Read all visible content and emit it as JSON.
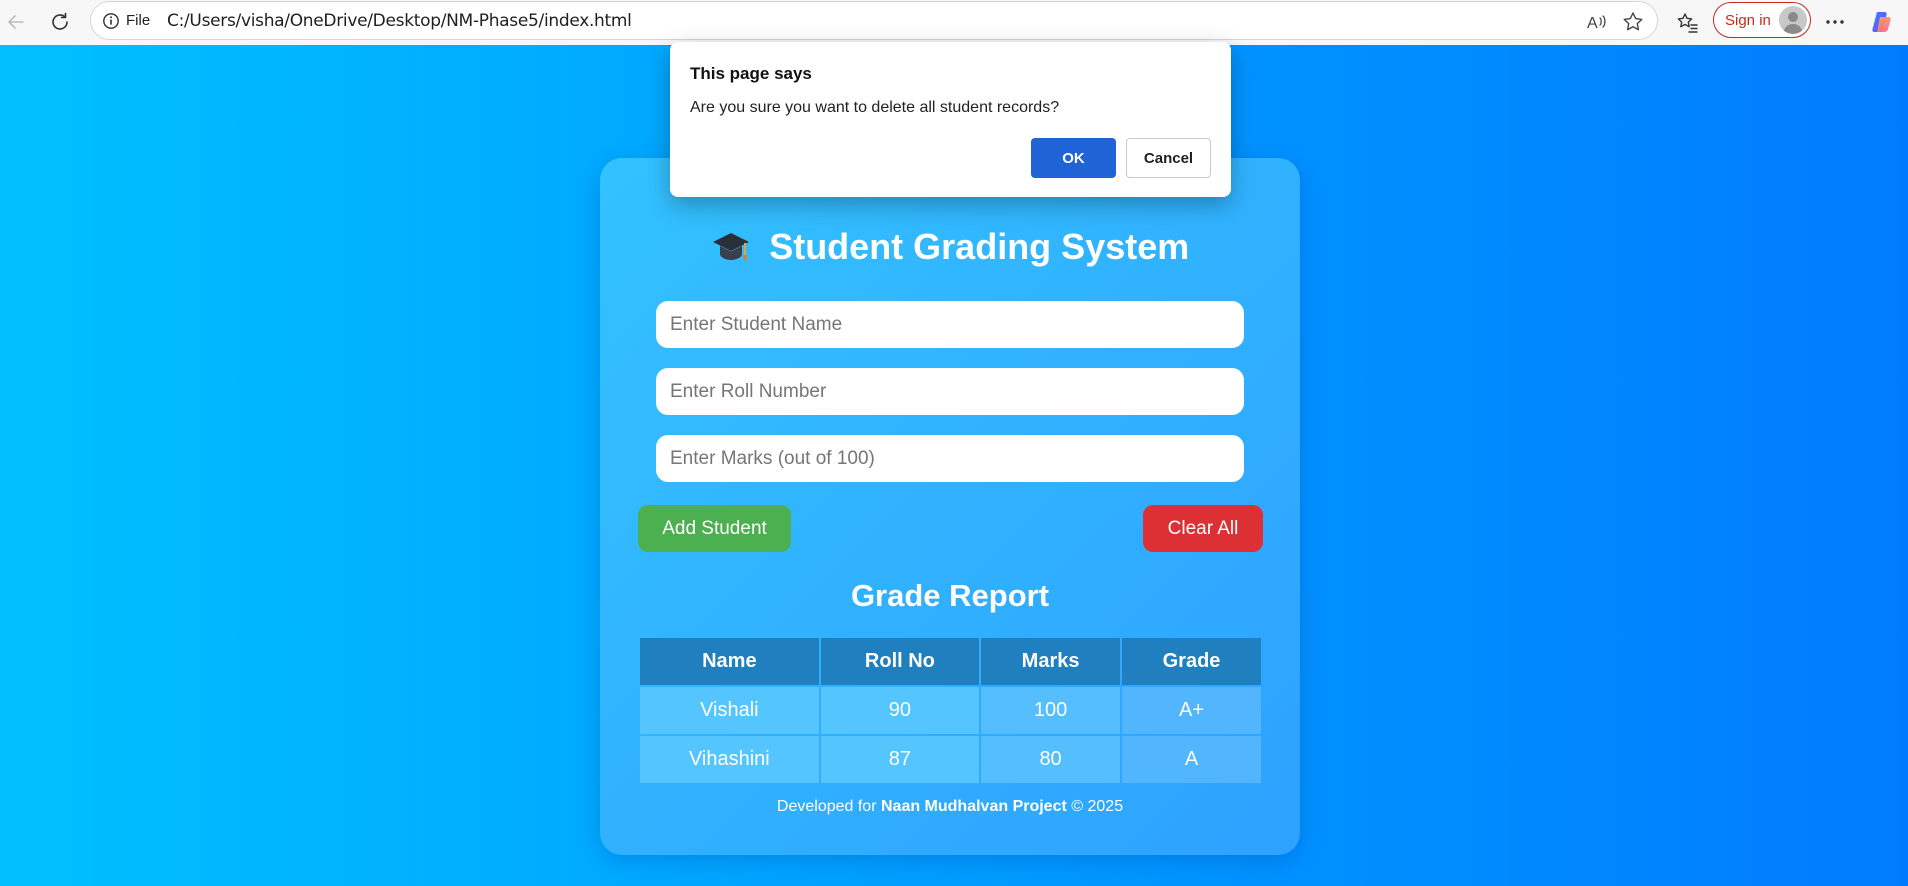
{
  "browser": {
    "file_label": "File",
    "url": "C:/Users/visha/OneDrive/Desktop/NM-Phase5/index.html",
    "signin_label": "Sign in",
    "icons": [
      "back-icon",
      "reload-icon",
      "info-icon",
      "read-aloud-icon",
      "favorite-star-icon",
      "favorites-icon",
      "profile-avatar-icon",
      "more-icon",
      "copilot-icon"
    ]
  },
  "app": {
    "title": "Student Grading System",
    "title_icon": "graduation-cap-icon",
    "inputs": {
      "name_placeholder": "Enter Student Name",
      "roll_placeholder": "Enter Roll Number",
      "marks_placeholder": "Enter Marks (out of 100)"
    },
    "buttons": {
      "add": "Add Student",
      "clear": "Clear All"
    },
    "report_title": "Grade Report",
    "table": {
      "headers": [
        "Name",
        "Roll No",
        "Marks",
        "Grade"
      ],
      "rows": [
        [
          "Vishali",
          "90",
          "100",
          "A+"
        ],
        [
          "Vihashini",
          "87",
          "80",
          "A"
        ]
      ]
    },
    "footer": {
      "prefix": "Developed for",
      "project": "Naan Mudhalvan Project",
      "suffix": "© 2025"
    },
    "colors": {
      "add_button": "#4caf50",
      "clear_button": "#dc3035",
      "gradient_start": "#00c0ff",
      "gradient_end": "#007bff"
    }
  },
  "dialog": {
    "title": "This page says",
    "message": "Are you sure you want to delete all student records?",
    "ok": "OK",
    "cancel": "Cancel"
  }
}
